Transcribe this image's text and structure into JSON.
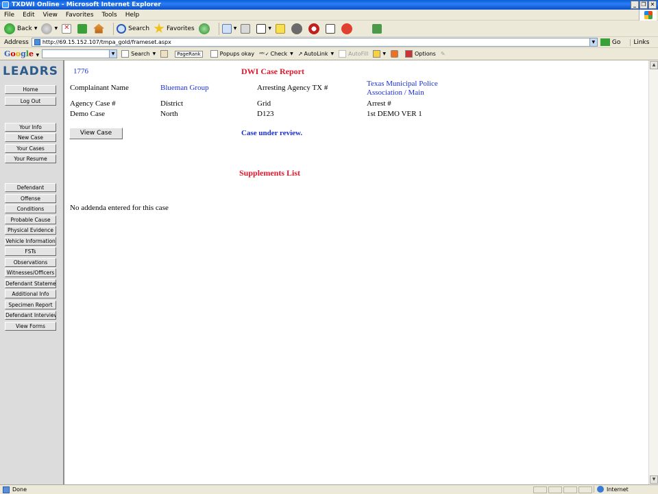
{
  "window": {
    "title": "TXDWI Online - Microsoft Internet Explorer"
  },
  "menu": [
    "File",
    "Edit",
    "View",
    "Favorites",
    "Tools",
    "Help"
  ],
  "toolbar": {
    "back": "Back",
    "search": "Search",
    "favorites": "Favorites"
  },
  "address": {
    "label": "Address",
    "url": "http://69.15.152.107/tmpa_gold/frameset.aspx",
    "go": "Go",
    "links": "Links"
  },
  "google_bar": {
    "search": "Search",
    "pagerank": "PageRank",
    "popups": "Popups okay",
    "check": "Check",
    "autolink": "AutoLink",
    "autofill": "AutoFill",
    "options": "Options"
  },
  "sidebar": {
    "logo": "LEADRS",
    "group1": [
      "Home",
      "Log Out"
    ],
    "group2": [
      "Your Info",
      "New Case",
      "Your Cases",
      "Your Resume"
    ],
    "group3": [
      "Defendant",
      "Offense",
      "Conditions",
      "Probable Cause",
      "Physical Evidence",
      "Vehicle Information",
      "FSTs",
      "Observations",
      "Witnesses/Officers",
      "Defendant Statemer",
      "Additional Info",
      "Specimen Report",
      "Defendant Interview",
      "View Forms"
    ]
  },
  "report": {
    "case_id": "1776",
    "title": "DWI Case Report",
    "complainant_label": "Complainant Name",
    "complainant_value": "Blueman Group",
    "arresting_label": "Arresting Agency TX #",
    "arresting_value_line1": "Texas Municipal Police",
    "arresting_value_line2": "Association / Main",
    "agency_case_label": "Agency Case #",
    "district_label": "District",
    "grid_label": "Grid",
    "arrest_label": "Arrest #",
    "agency_case_value": "Demo Case",
    "district_value": "North",
    "grid_value": "D123",
    "arrest_value": "1st DEMO VER 1",
    "view_case_button": "View Case",
    "status": "Case under review.",
    "supplements_title": "Supplements List",
    "no_addenda": "No addenda entered for this case"
  },
  "statusbar": {
    "text": "Done",
    "zone": "Internet"
  }
}
